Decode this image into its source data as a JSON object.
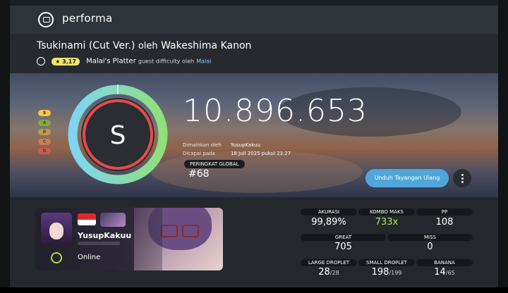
{
  "app": {
    "title": "performa"
  },
  "beatmap": {
    "title": "Tsukinami (Cut Ver.)",
    "by_label": "oleh",
    "artist": "Wakeshima Kanon",
    "star_rating": "★ 3,17",
    "difficulty": "Malai's Platter",
    "guest_text": "guest difficulty oleh",
    "mapper": "Malai"
  },
  "score": {
    "grade": "S",
    "total": "10.896.653",
    "ranks": [
      "S",
      "A",
      "B",
      "C",
      "D"
    ],
    "played_by_label": "Dimainkan oleh",
    "played_by": "YusupKakuu",
    "achieved_label": "Dicapai pada",
    "achieved_at": "18 Juli 2025 pukul 23.27",
    "global_rank_label": "PERINGKAT GLOBAL",
    "global_rank": "#68",
    "replay_button": "Unduh Tayangan Ulang",
    "accuracy_fraction": 0.9989
  },
  "user": {
    "name": "YusupKakuu",
    "status": "Online",
    "country": "Indonesia"
  },
  "stats": {
    "accuracy_label": "AKURASI",
    "accuracy": "99,89%",
    "max_combo_label": "KOMBO MAKS",
    "max_combo": "733x",
    "pp_label": "PP",
    "pp": "108",
    "great_label": "GREAT",
    "great": "705",
    "miss_label": "MISS",
    "miss": "0",
    "large_droplet_label": "LARGE DROPLET",
    "large_droplet": "28",
    "large_droplet_max": "/28",
    "small_droplet_label": "SMALL DROPLET",
    "small_droplet": "198",
    "small_droplet_max": "/199",
    "banana_label": "BANANA",
    "banana": "14",
    "banana_max": "/65"
  },
  "colors": {
    "accent": "#4fa6d8",
    "combo": "#b3e75b",
    "star_badge": "#f2e46a",
    "online": "#b5d930",
    "rank_s": "#f8c443",
    "rank_a": "#88da20",
    "rank_b": "#e9b941",
    "rank_c": "#ff8e5d",
    "rank_d": "#ff5a5a"
  }
}
